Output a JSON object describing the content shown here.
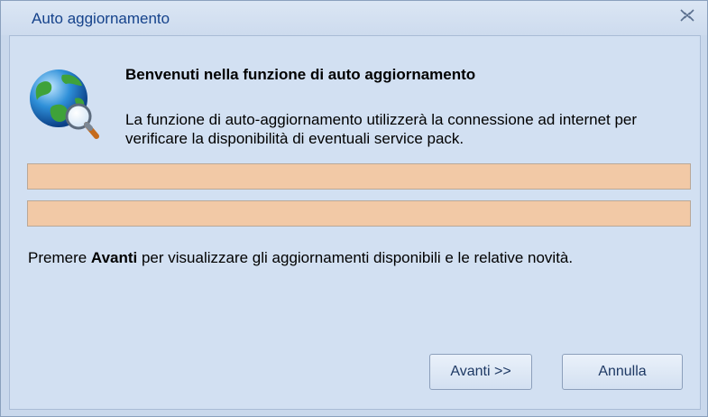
{
  "window": {
    "title": "Auto aggiornamento",
    "close_glyph": "☒"
  },
  "header": {
    "icon": "globe-search-icon",
    "heading": "Benvenuti nella funzione di auto aggiornamento",
    "description": "La funzione di auto-aggiornamento utilizzerà la connessione ad internet per verificare la disponibilità di eventuali service pack."
  },
  "progress_bars": [
    {
      "label": ""
    },
    {
      "label": ""
    }
  ],
  "instruction": {
    "prefix": "Premere ",
    "bold": "Avanti",
    "suffix": " per visualizzare gli aggiornamenti disponibili e le relative novità."
  },
  "buttons": {
    "next_label": "Avanti >>",
    "cancel_label": "Annulla"
  },
  "colors": {
    "title_text": "#15428b",
    "background": "#d2e0f2",
    "bar_fill": "#f2c9a6"
  }
}
